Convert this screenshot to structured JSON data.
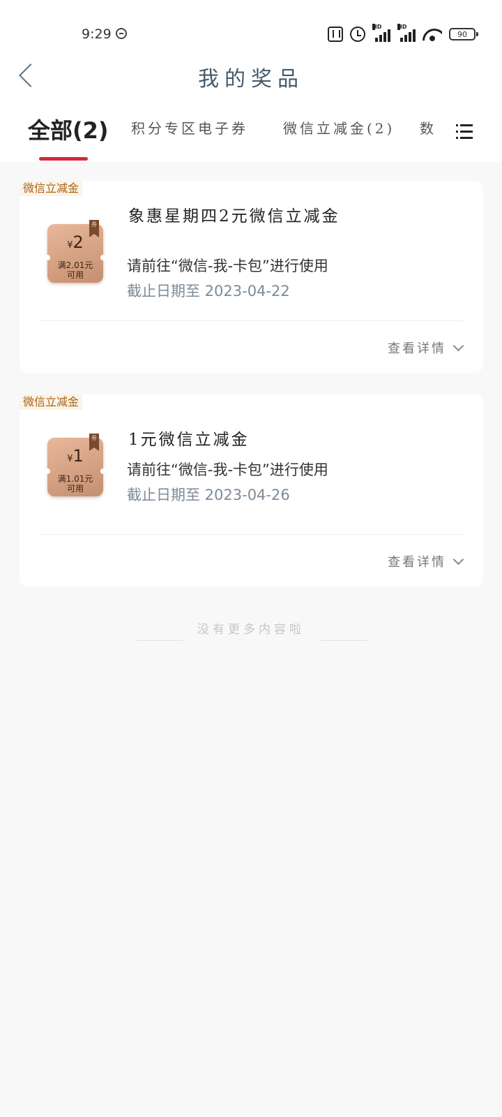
{
  "status_bar": {
    "time": "9:29",
    "battery": "90",
    "hd_label": "HD"
  },
  "header": {
    "title": "我的奖品"
  },
  "tabs": [
    {
      "label": "全部(2)",
      "active": true
    },
    {
      "label": "积分专区电子券",
      "active": false
    },
    {
      "label": "微信立减金(2)",
      "active": false
    },
    {
      "label": "数",
      "active": false
    }
  ],
  "prizes": [
    {
      "tag": "微信立减金",
      "coupon": {
        "currency": "¥",
        "amount": "2",
        "condition_line1": "满2.01元",
        "condition_line2": "可用",
        "ribbon": "券"
      },
      "title": "象惠星期四2元微信立减金",
      "instruction": "请前往“微信-我-卡包”进行使用",
      "expiry": "截止日期至 2023-04-22",
      "detail_label": "查看详情"
    },
    {
      "tag": "微信立减金",
      "coupon": {
        "currency": "¥",
        "amount": "1",
        "condition_line1": "满1.01元",
        "condition_line2": "可用",
        "ribbon": "券"
      },
      "title": "1元微信立减金",
      "instruction": "请前往“微信-我-卡包”进行使用",
      "expiry": "截止日期至 2023-04-26",
      "detail_label": "查看详情"
    }
  ],
  "footer": {
    "end_note": "没有更多内容啦"
  },
  "colors": {
    "accent": "#d6283c",
    "tag_text": "#a5661d",
    "title_color": "#45596a"
  }
}
